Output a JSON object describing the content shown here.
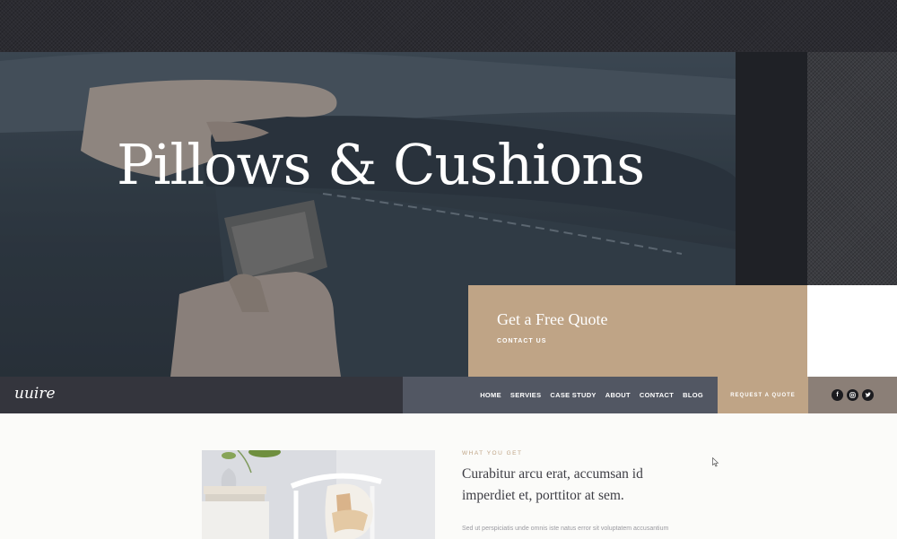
{
  "hero": {
    "title": "Pillows & Cushions"
  },
  "quote_box": {
    "title": "Get a Free Quote",
    "link": "CONTACT US"
  },
  "nav": {
    "logo": "uuire",
    "links": [
      "HOME",
      "SERVIES",
      "CASE STUDY",
      "ABOUT",
      "CONTACT",
      "BLOG"
    ],
    "request_button": "REQUEST A QUOTE",
    "social_icons": [
      "facebook-icon",
      "instagram-icon",
      "twitter-icon"
    ]
  },
  "content": {
    "eyebrow": "WHAT YOU GET",
    "heading": "Curabitur arcu erat, accumsan id imperdiet et, porttitor at sem.",
    "body": "Sed ut perspiciatis unde omnis iste natus error sit voluptatem accusantium"
  },
  "colors": {
    "accent": "#bfa486",
    "nav_dark": "#34353d",
    "nav_mid": "#525763",
    "social_bg": "#8b7f77"
  }
}
